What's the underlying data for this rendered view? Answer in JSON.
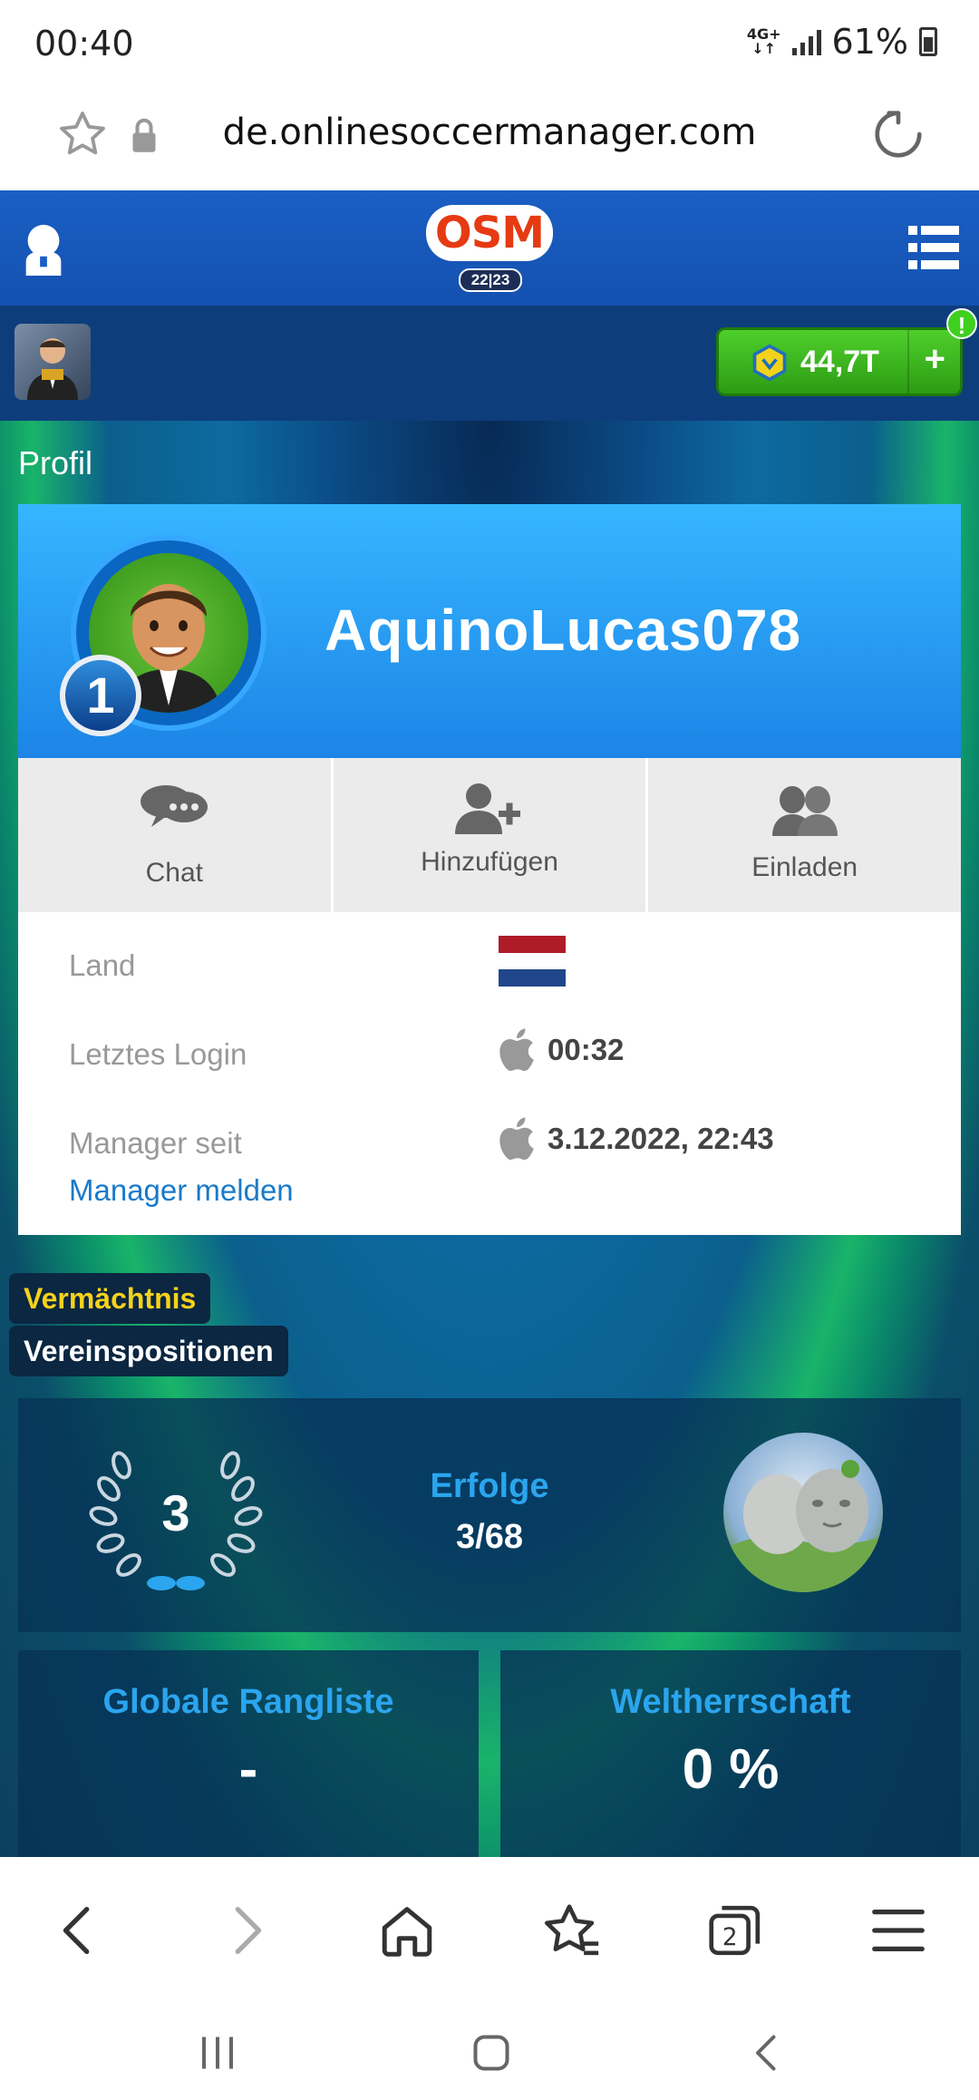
{
  "status_bar": {
    "time": "00:40",
    "network": "4G+",
    "battery": "61%"
  },
  "browser": {
    "url": "de.onlinesoccermanager.com",
    "tabs_count": "2"
  },
  "game_header": {
    "logo_text": "OSM",
    "season": "22|23"
  },
  "wallet": {
    "coins": "44,7T",
    "plus": "+",
    "alert": "!"
  },
  "page": {
    "section_label": "Profil"
  },
  "profile": {
    "username": "AquinoLucas078",
    "rank": "1",
    "actions": [
      {
        "label": "Chat"
      },
      {
        "label": "Hinzufügen"
      },
      {
        "label": "Einladen"
      }
    ],
    "info": {
      "country_label": "Land",
      "country_flag_colors": [
        "#ae1c28",
        "#ffffff",
        "#21468b"
      ],
      "last_login_label": "Letztes Login",
      "last_login_value": "00:32",
      "manager_since_label": "Manager seit",
      "manager_since_value": "3.12.2022, 22:43",
      "report_link": "Manager melden"
    }
  },
  "legacy": {
    "tag_legacy": "Vermächtnis",
    "tag_positions": "Vereinspositionen",
    "wreath_count": "3",
    "achievements_title": "Erfolge",
    "achievements_value": "3/68",
    "global_ranking_title": "Globale Rangliste",
    "global_ranking_value": "-",
    "world_domination_title": "Weltherrschaft",
    "world_domination_value": "0 %"
  },
  "colors": {
    "brand_blue": "#1a5fc4",
    "accent_blue": "#2aa5ee",
    "coin_green": "#3fb81f",
    "link": "#1a7acb",
    "legacy_yellow": "#f6d21c"
  }
}
